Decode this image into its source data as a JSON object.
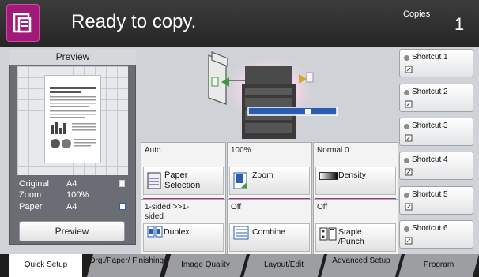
{
  "header": {
    "status": "Ready to copy.",
    "copies_label": "Copies",
    "copies_value": "1"
  },
  "preview": {
    "title": "Preview",
    "original_label": "Original",
    "original_value": "A4",
    "zoom_label": "Zoom",
    "zoom_value": "100%",
    "paper_label": "Paper",
    "paper_value": "A4",
    "button_label": "Preview"
  },
  "functions": [
    {
      "value": "Auto",
      "label": "Paper Selection",
      "icon": "paper-icon"
    },
    {
      "value": "100%",
      "label": "Zoom",
      "icon": "zoom-icon"
    },
    {
      "value": "Normal 0",
      "label": "Density",
      "icon": "density-icon"
    },
    {
      "value": "1-sided >>1-sided",
      "label": "Duplex",
      "icon": "duplex-icon"
    },
    {
      "value": "Off",
      "label": "Combine",
      "icon": "combine-icon"
    },
    {
      "value": "Off",
      "label": "Staple /Punch",
      "icon": "staple-icon"
    }
  ],
  "shortcuts": [
    "Shortcut 1",
    "Shortcut 2",
    "Shortcut 3",
    "Shortcut 4",
    "Shortcut 5",
    "Shortcut 6"
  ],
  "tabs": [
    "Quick Setup",
    "Org./Paper/ Finishing",
    "Image Quality",
    "Layout/Edit",
    "Advanced Setup",
    "Program"
  ],
  "colors": {
    "accent": "#9c2d8a",
    "header_bg": "#2f2f2f",
    "panel_bg": "#cfd2d6"
  }
}
